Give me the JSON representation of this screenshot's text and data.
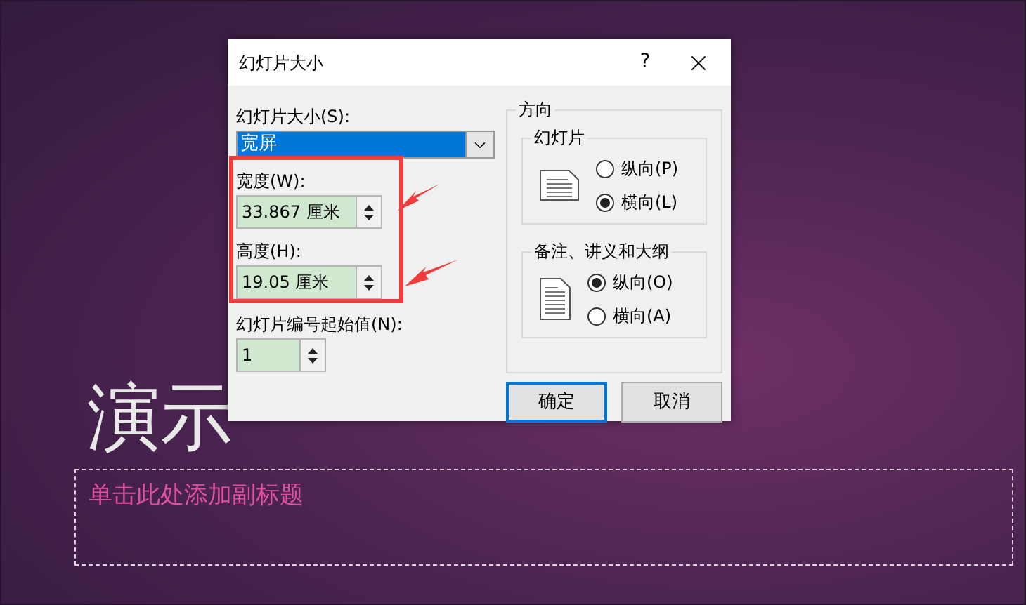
{
  "slide": {
    "title": "演示",
    "subtitle_placeholder": "单击此处添加副标题"
  },
  "dialog": {
    "title": "幻灯片大小",
    "help": "?",
    "size_label": "幻灯片大小(S):",
    "size_value": "宽屏",
    "fields": [
      {
        "label": "宽度(W):",
        "value": "33.867 厘米"
      },
      {
        "label": "高度(H):",
        "value": "19.05 厘米"
      }
    ],
    "start": {
      "label": "幻灯片编号起始值(N):",
      "value": "1"
    },
    "orientation": {
      "title": "方向",
      "groups": [
        {
          "title": "幻灯片",
          "options": [
            {
              "label": "纵向(P)",
              "selected": false
            },
            {
              "label": "横向(L)",
              "selected": true
            }
          ]
        },
        {
          "title": "备注、讲义和大纲",
          "options": [
            {
              "label": "纵向(O)",
              "selected": true
            },
            {
              "label": "横向(A)",
              "selected": false
            }
          ]
        }
      ]
    },
    "buttons": [
      {
        "label": "确定",
        "default": true
      },
      {
        "label": "取消",
        "default": false
      }
    ]
  }
}
